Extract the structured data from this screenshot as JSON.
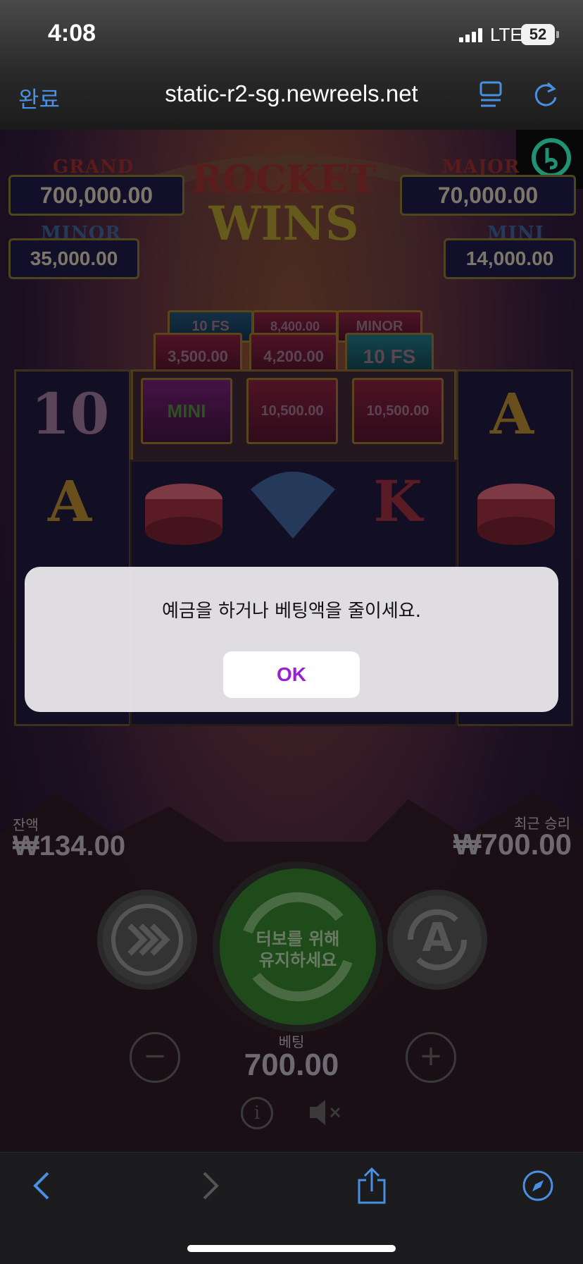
{
  "status_bar": {
    "time": "4:08",
    "network": "LTE",
    "battery": "52"
  },
  "browser": {
    "done_label": "완료",
    "url": "static-r2-sg.newreels.net"
  },
  "jackpots": {
    "grand": {
      "label": "GRAND",
      "value": "700,000.00"
    },
    "major": {
      "label": "MAJOR",
      "value": "70,000.00"
    },
    "minor": {
      "label": "MINOR",
      "value": "35,000.00"
    },
    "mini": {
      "label": "MINI",
      "value": "14,000.00"
    }
  },
  "game_title": {
    "line1": "ROCKET",
    "line2": "WINS"
  },
  "tiles": {
    "row0": [
      "10 FS",
      "8,400.00",
      "MINOR"
    ],
    "row1": [
      "3,500.00",
      "4,200.00",
      "10 FS"
    ],
    "row2": [
      "MINI",
      "10,500.00",
      "10,500.00"
    ]
  },
  "symbols": {
    "ten": "10",
    "a": "A",
    "k": "K"
  },
  "dialog": {
    "message": "예금을 하거나 베팅액을 줄이세요.",
    "ok_label": "OK"
  },
  "balance": {
    "label": "잔액",
    "value": "₩134.00"
  },
  "last_win": {
    "label": "최근 승리",
    "value": "₩700.00"
  },
  "spin_button": {
    "line1": "터보를 위해",
    "line2": "유지하세요"
  },
  "autoplay_label": "A",
  "bet": {
    "label": "베팅",
    "value": "700.00",
    "minus": "−",
    "plus": "+"
  },
  "info_label": "i"
}
